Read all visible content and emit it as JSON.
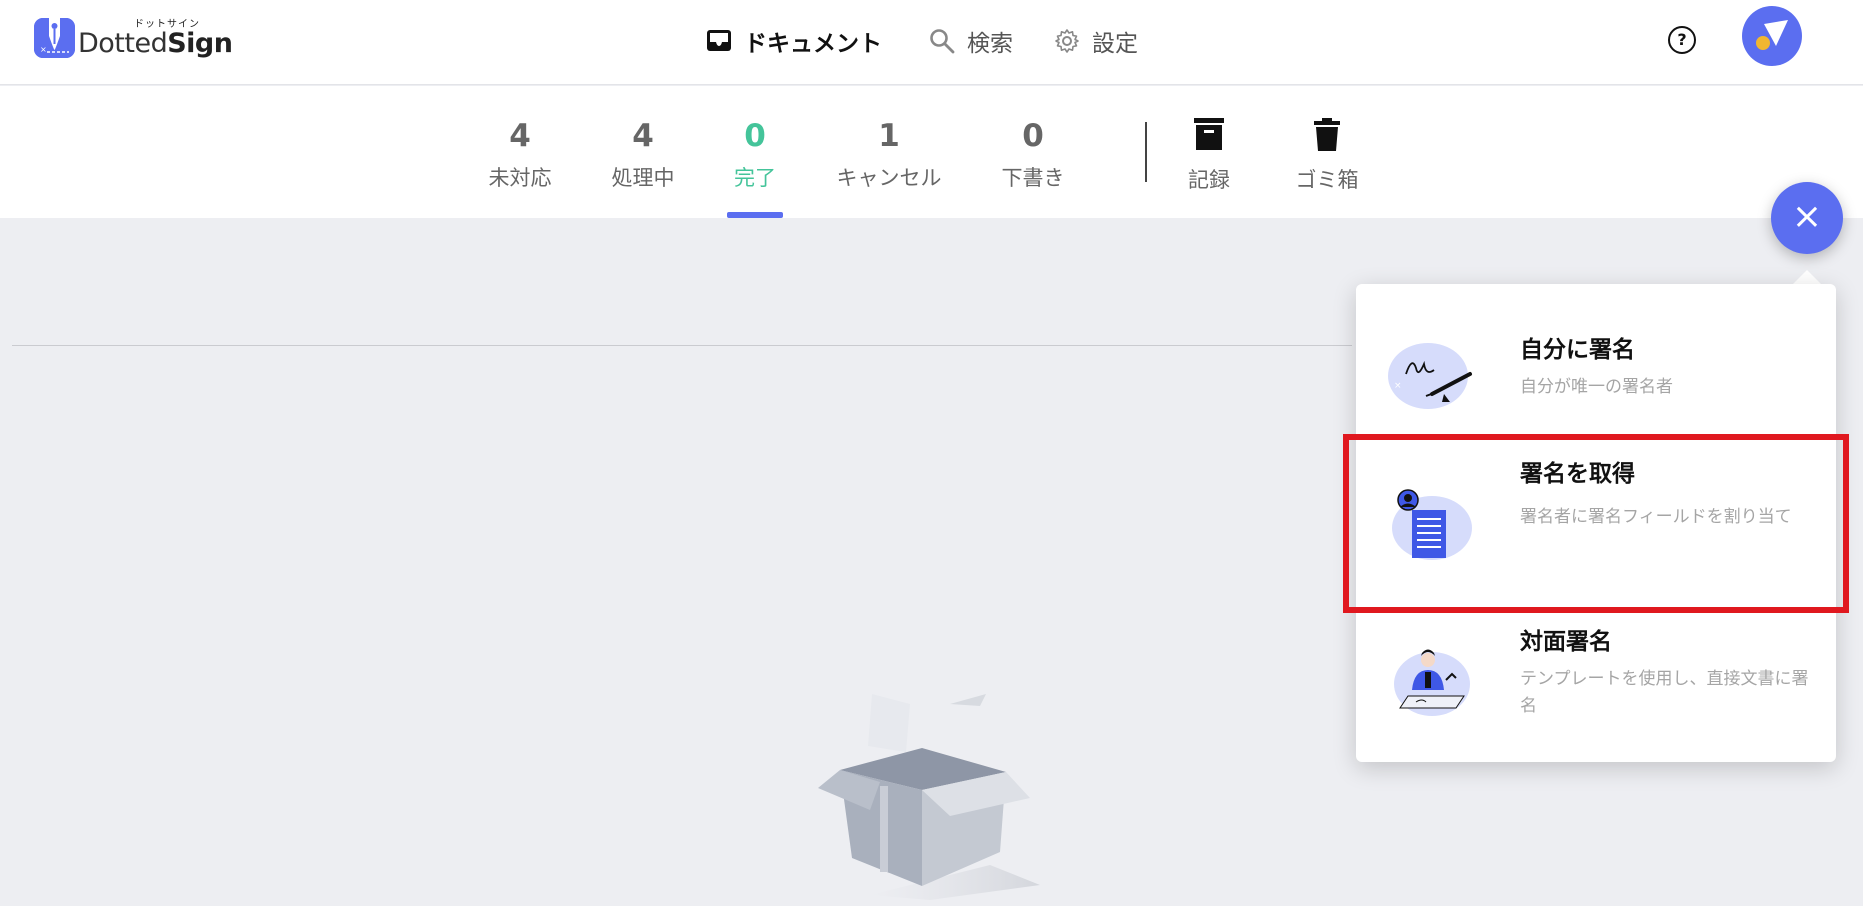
{
  "header": {
    "logo": {
      "kana": "ドットサイン",
      "text_light": "Dotted",
      "text_bold": "Sign"
    },
    "nav": [
      {
        "label": "ドキュメント",
        "icon": "inbox-icon",
        "active": true
      },
      {
        "label": "検索",
        "icon": "search-icon",
        "active": false
      },
      {
        "label": "設定",
        "icon": "gear-icon",
        "active": false
      }
    ],
    "help_label": "?"
  },
  "tabs": [
    {
      "count": "4",
      "label": "未対応"
    },
    {
      "count": "4",
      "label": "処理中"
    },
    {
      "count": "0",
      "label": "完了",
      "active": true
    },
    {
      "count": "1",
      "label": "キャンセル"
    },
    {
      "count": "0",
      "label": "下書き"
    }
  ],
  "icon_tabs": [
    {
      "label": "記録",
      "icon": "archive-icon"
    },
    {
      "label": "ゴミ箱",
      "icon": "trash-icon"
    }
  ],
  "fab": {
    "label": "×"
  },
  "menu": [
    {
      "title": "自分に署名",
      "desc": "自分が唯一の署名者"
    },
    {
      "title": "署名を取得",
      "desc": "署名者に署名フィールドを割り当て"
    },
    {
      "title": "対面署名",
      "desc": "テンプレートを使用し、直接文書に署名"
    }
  ],
  "colors": {
    "accent": "#5b6ef0",
    "done_green": "#44c49a",
    "highlight_red": "#e0181f"
  }
}
